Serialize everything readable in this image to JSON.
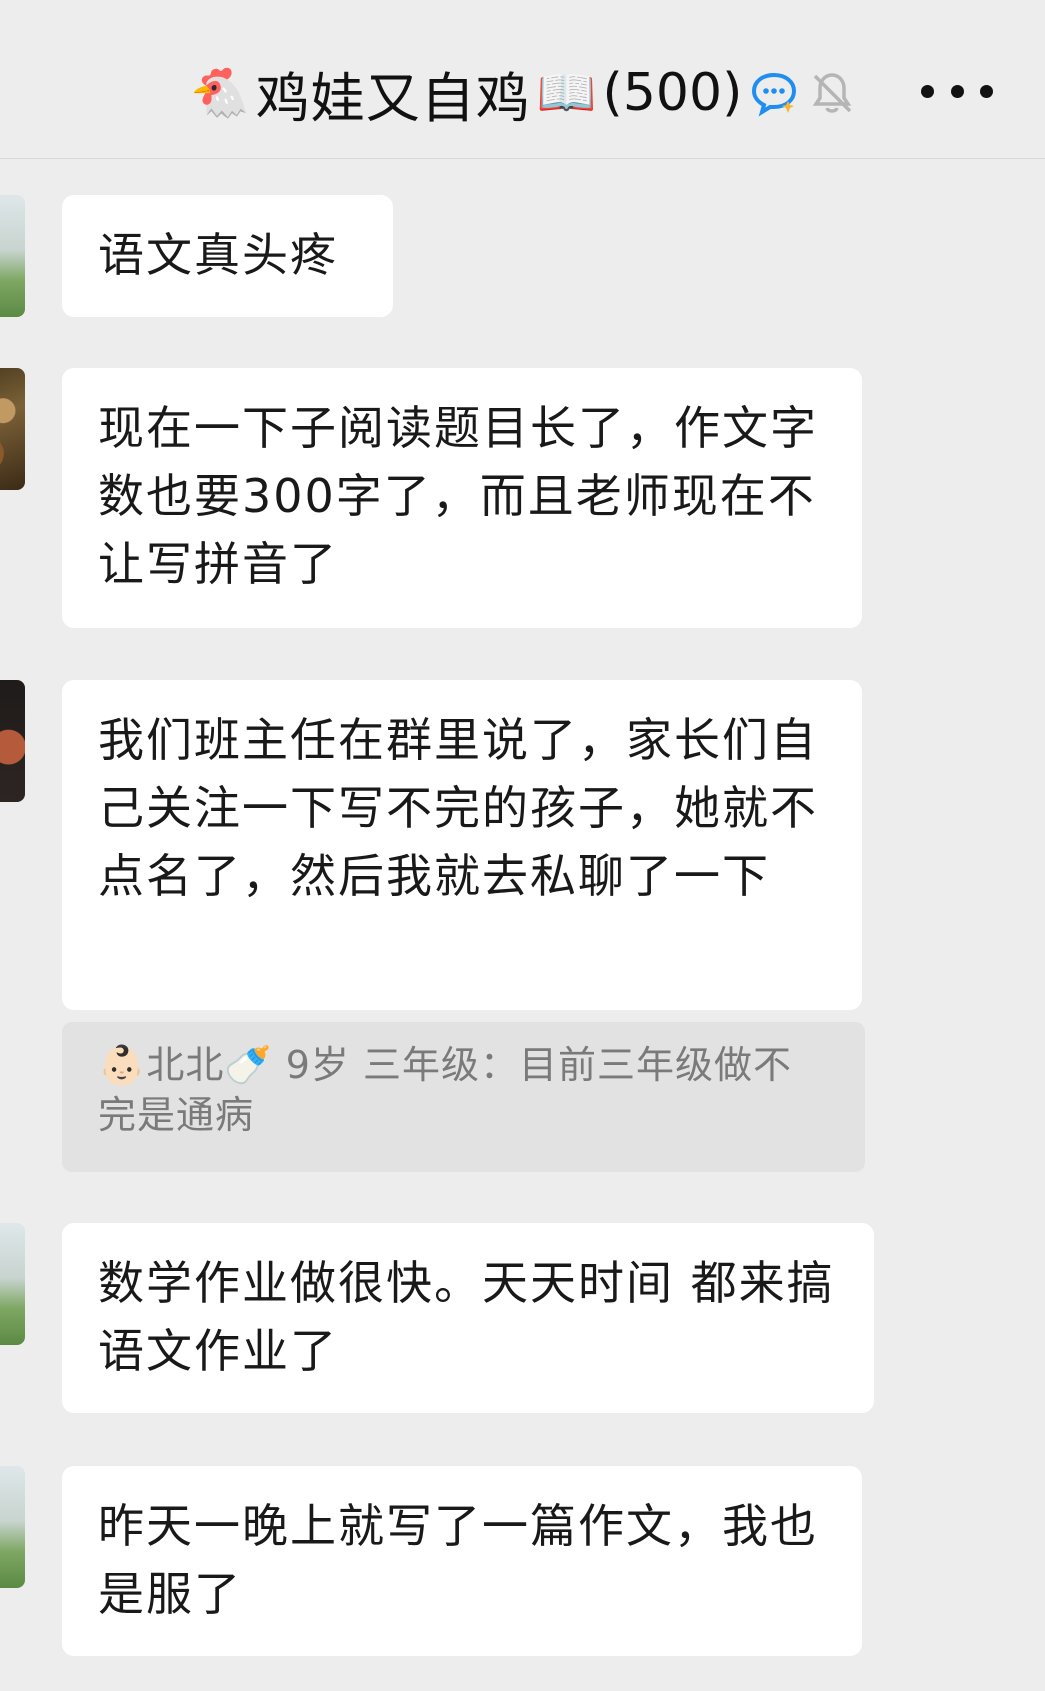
{
  "header": {
    "title_prefix_emoji": "🐔",
    "title": "鸡娃又自鸡",
    "title_suffix_emoji": "📖",
    "member_count": "(500)",
    "chat_bubble_icon": "chat-bubble-icon",
    "mute_icon": "bell-muted-icon",
    "more_icon": "more-dots-icon"
  },
  "messages": [
    {
      "avatar": "landscape-avatar",
      "text": "语文真头疼"
    },
    {
      "avatar": "bark-avatar",
      "text": "现在一下子阅读题目长了，作文字数也要300字了，而且老师现在不让写拼音了"
    },
    {
      "avatar": "dark-avatar",
      "text": "我们班主任在群里说了，家长们自己关注一下写不完的孩子，她就不点名了，然后我就去私聊了一下"
    },
    {
      "avatar": "landscape-avatar",
      "text": "数学作业做很快。天天时间 都来搞语文作业了"
    },
    {
      "avatar": "landscape-avatar",
      "text": "昨天一晚上就写了一篇作文，我也是服了"
    }
  ],
  "quote": {
    "emoji_before": "👶🏻",
    "name": "北北",
    "emoji_after": "🍼",
    "text": " 9岁 三年级：目前三年级做不完是通病"
  },
  "colors": {
    "background": "#ededed",
    "bubble": "#ffffff",
    "quote_bg": "#e2e2e2",
    "quote_text": "#7a7a7a",
    "text": "#191919",
    "chat_icon": "#1f8ef1"
  }
}
